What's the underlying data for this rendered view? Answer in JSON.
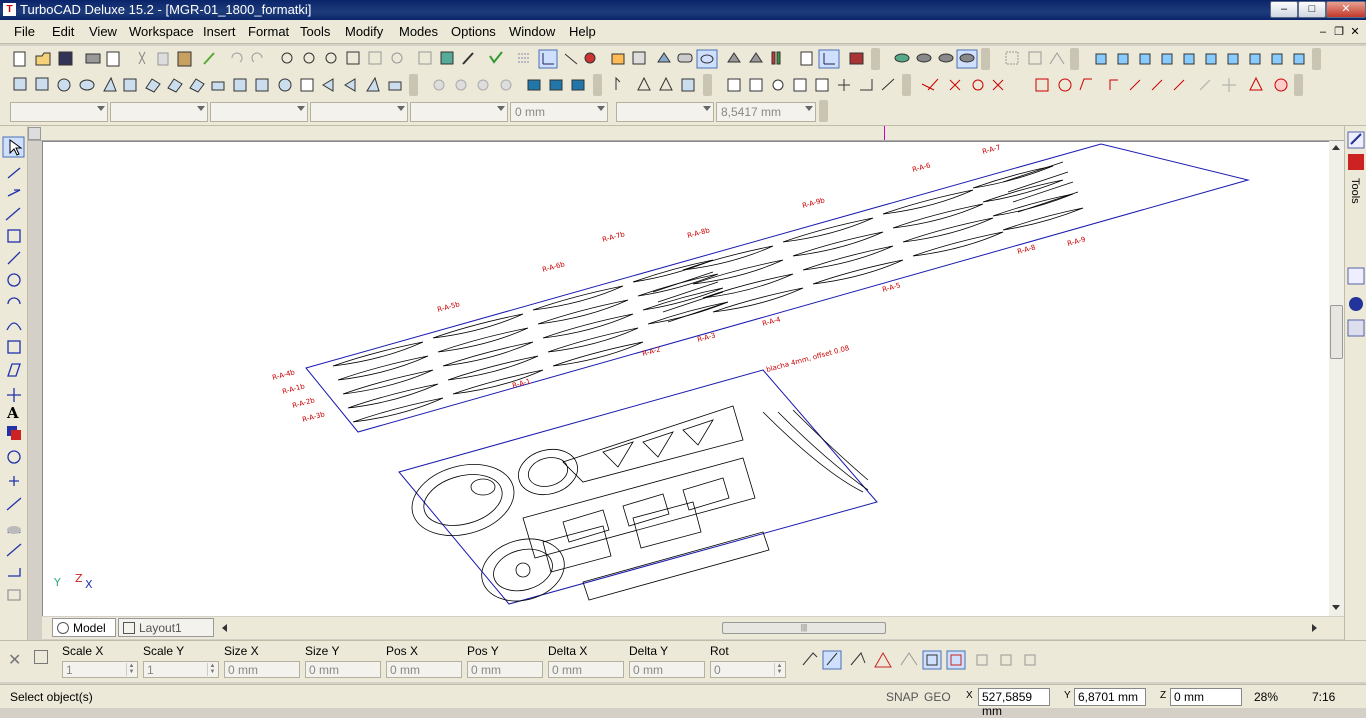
{
  "window": {
    "title": "TurboCAD Deluxe 15.2 - [MGR-01_1800_formatki]",
    "buttons": [
      "–",
      "□",
      "✕"
    ]
  },
  "menu": {
    "items": [
      "File",
      "Edit",
      "View",
      "Workspace",
      "Insert",
      "Format",
      "Tools",
      "Modify",
      "Modes",
      "Options",
      "Window",
      "Help"
    ]
  },
  "property_bar": {
    "combos": [
      "",
      "",
      "",
      "",
      "",
      "0 mm",
      "",
      "8,5417 mm"
    ]
  },
  "drawing": {
    "label_note": "blacha 4mm, offset 0.08",
    "part_labels": [
      "R-A-4b",
      "R-A-1b",
      "R-A-2b",
      "R-A-3b",
      "R-A-5b",
      "R-A-6b",
      "R-A-7b",
      "R-A-8b",
      "R-A-9b",
      "R-A-1",
      "R-A-2",
      "R-A-3",
      "R-A-4",
      "R-A-5",
      "R-A-6",
      "R-A-7",
      "R-A-8",
      "R-A-9"
    ]
  },
  "right_panel": {
    "tools_label": "Tools"
  },
  "tabs": [
    {
      "label": "Model",
      "active": true
    },
    {
      "label": "Layout1",
      "active": false
    }
  ],
  "inspector": {
    "fields": [
      {
        "label": "Scale X",
        "value": "1"
      },
      {
        "label": "Scale Y",
        "value": "1"
      },
      {
        "label": "Size X",
        "value": "0 mm"
      },
      {
        "label": "Size Y",
        "value": "0 mm"
      },
      {
        "label": "Pos X",
        "value": "0 mm"
      },
      {
        "label": "Pos Y",
        "value": "0 mm"
      },
      {
        "label": "Delta X",
        "value": "0 mm"
      },
      {
        "label": "Delta Y",
        "value": "0 mm"
      },
      {
        "label": "Rot",
        "value": "0"
      }
    ]
  },
  "status": {
    "message": "Select object(s)",
    "snap": "SNAP",
    "geo": "GEO",
    "x": "527,5859 mm",
    "y": "6,8701 mm",
    "z": "0 mm",
    "zoom": "28%",
    "time": "7:16"
  },
  "colors": {
    "title_bg": "#0a246a",
    "chrome_bg": "#ece9d8",
    "drawing_lines": "#000000",
    "label_red": "#cc0000",
    "sheet_outline": "#1a1ab0"
  },
  "axis_labels": {
    "y": "Y",
    "z": "Z",
    "x": "X"
  }
}
